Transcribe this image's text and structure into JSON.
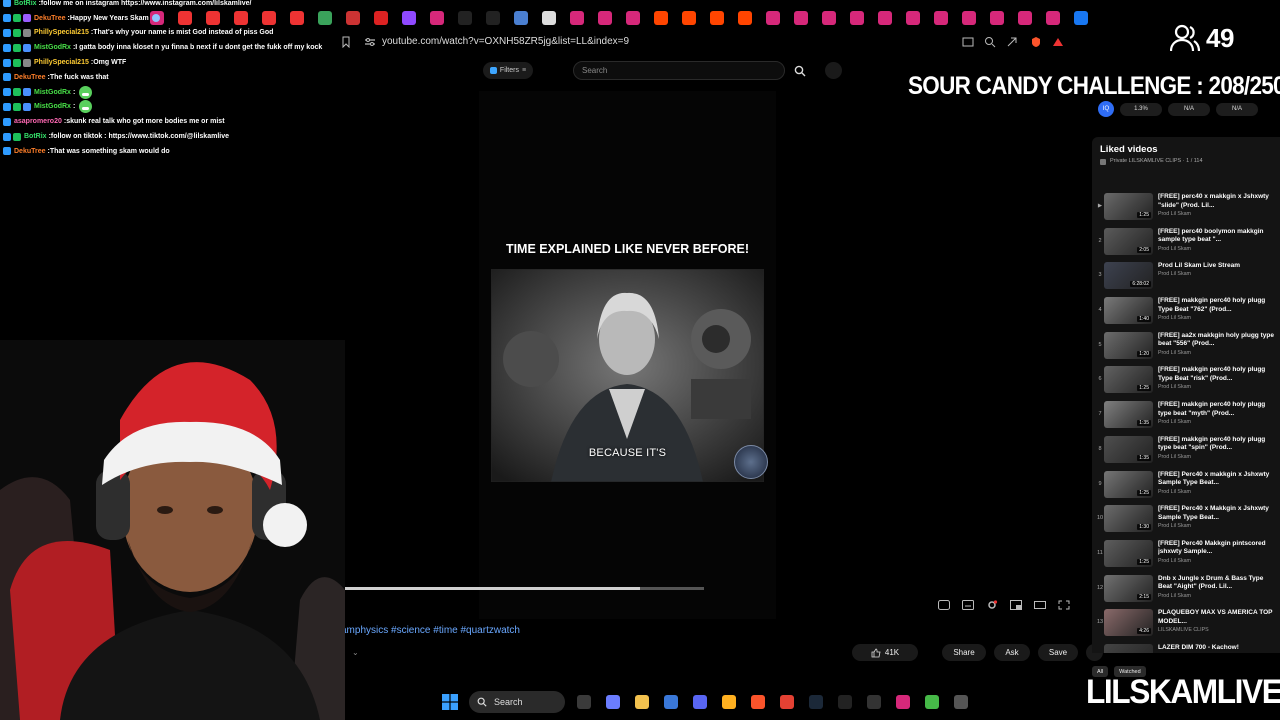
{
  "browser": {
    "tabs": [
      {
        "icon": "instagram-icon",
        "color": "#d6287a"
      },
      {
        "icon": "youtube-icon",
        "color": "#e33"
      },
      {
        "icon": "youtube-icon",
        "color": "#e33"
      },
      {
        "icon": "youtube-icon",
        "color": "#e33"
      },
      {
        "icon": "youtube-icon",
        "color": "#e33"
      },
      {
        "icon": "youtube-icon",
        "color": "#e33"
      },
      {
        "icon": "chrome-web-icon",
        "color": "#3aa35b"
      },
      {
        "icon": "red-app-icon",
        "color": "#c33"
      },
      {
        "icon": "pinterest-icon",
        "color": "#d22"
      },
      {
        "icon": "twitch-icon",
        "color": "#8f49ff"
      },
      {
        "icon": "instagram-icon",
        "color": "#d6287a"
      },
      {
        "icon": "tiktok-icon",
        "color": "#222"
      },
      {
        "icon": "x-icon",
        "color": "#222"
      },
      {
        "icon": "grid-app-icon",
        "color": "#4a7fd1"
      },
      {
        "icon": "google-icon",
        "color": "#ddd"
      },
      {
        "icon": "instagram-icon",
        "color": "#d6287a"
      },
      {
        "icon": "instagram-icon",
        "color": "#d6287a"
      },
      {
        "icon": "instagram-icon",
        "color": "#d6287a"
      },
      {
        "icon": "reddit-icon",
        "color": "#ff4500"
      },
      {
        "icon": "reddit-icon",
        "color": "#ff4500"
      },
      {
        "icon": "reddit-icon",
        "color": "#ff4500"
      },
      {
        "icon": "reddit-icon",
        "color": "#ff4500"
      },
      {
        "icon": "instagram-icon",
        "color": "#d6287a"
      },
      {
        "icon": "instagram-icon",
        "color": "#d6287a"
      },
      {
        "icon": "instagram-icon",
        "color": "#d6287a"
      },
      {
        "icon": "instagram-icon",
        "color": "#d6287a"
      },
      {
        "icon": "instagram-icon",
        "color": "#d6287a"
      },
      {
        "icon": "instagram-icon",
        "color": "#d6287a"
      },
      {
        "icon": "instagram-icon",
        "color": "#d6287a"
      },
      {
        "icon": "instagram-icon",
        "color": "#d6287a"
      },
      {
        "icon": "instagram-icon",
        "color": "#d6287a"
      },
      {
        "icon": "instagram-icon",
        "color": "#d6287a"
      },
      {
        "icon": "instagram-icon",
        "color": "#d6287a"
      },
      {
        "icon": "facebook-icon",
        "color": "#1877f2"
      }
    ],
    "url": "youtube.com/watch?v=OXNH58ZR5jg&list=LL&index=9"
  },
  "youtube": {
    "filters_label": "Filters",
    "search_placeholder": "Search",
    "video_title": "TIME EXPLAINED LIKE NEVER BEFORE!",
    "caption": "BECAUSE IT'S",
    "hashtags": "amphysics #science #time #quartzwatch",
    "likes": "41K",
    "share_label": "Share",
    "ask_label": "Ask",
    "save_label": "Save",
    "progress_fraction": 0.83
  },
  "extension_stats": {
    "logo": "IQ",
    "values": [
      "1.3%",
      "N/A",
      "N/A"
    ]
  },
  "playlist": {
    "title": "Liked videos",
    "subtitle": "Private  LILSKAMLIVE CLIPS  ·  1 / 114",
    "items": [
      {
        "index": "▶",
        "title": "[FREE] perc40 x makkgin x Jshxwty \"slide\" (Prod. Lil...",
        "channel": "Prod Lil Skam",
        "duration": "1:25",
        "thumb": "#6a6a6a"
      },
      {
        "index": "2",
        "title": "[FREE] perc40 boolymon makkgin sample type beat \"...",
        "channel": "Prod Lil Skam",
        "duration": "2:05",
        "thumb": "#5b5b5b"
      },
      {
        "index": "3",
        "title": "Prod Lil Skam Live Stream",
        "channel": "Prod Lil Skam",
        "duration": "6:28:02",
        "thumb": "#3d4250"
      },
      {
        "index": "4",
        "title": "[FREE] makkgin perc40 holy plugg Type Beat \"762\" (Prod...",
        "channel": "Prod Lil Skam",
        "duration": "1:40",
        "thumb": "#7a7a7a"
      },
      {
        "index": "5",
        "title": "[FREE] aa2x makkgin holy plugg type beat \"556\" (Prod...",
        "channel": "Prod Lil Skam",
        "duration": "1:20",
        "thumb": "#6d6d6d"
      },
      {
        "index": "6",
        "title": "[FREE] makkgin perc40 holy plugg Type Beat \"risk\" (Prod...",
        "channel": "Prod Lil Skam",
        "duration": "1:25",
        "thumb": "#626262"
      },
      {
        "index": "7",
        "title": "[FREE] makkgin perc40 holy plugg type beat \"myth\" (Prod...",
        "channel": "Prod Lil Skam",
        "duration": "1:35",
        "thumb": "#808080"
      },
      {
        "index": "8",
        "title": "[FREE] makkgin perc40 holy plugg type beat \"spin\" (Prod...",
        "channel": "Prod Lil Skam",
        "duration": "1:35",
        "thumb": "#4f4f4f"
      },
      {
        "index": "9",
        "title": "[FREE] Perc40 x makkgin x Jshxwty Sample Type Beat...",
        "channel": "Prod Lil Skam",
        "duration": "1:25",
        "thumb": "#767676"
      },
      {
        "index": "10",
        "title": "[FREE] Perc40 x Makkgin x Jshxwty Sample Type Beat...",
        "channel": "Prod Lil Skam",
        "duration": "1:30",
        "thumb": "#6c6c6c"
      },
      {
        "index": "11",
        "title": "[FREE] Perc40 Makkgin pintscored jshxwty Sample...",
        "channel": "Prod Lil Skam",
        "duration": "1:25",
        "thumb": "#5e5e5e"
      },
      {
        "index": "12",
        "title": "Dnb x Jungle x Drum & Bass Type Beat \"Aight\" (Prod. Lil...",
        "channel": "Prod Lil Skam",
        "duration": "2:15",
        "thumb": "#717171"
      },
      {
        "index": "13",
        "title": "PLAQUEBOY MAX VS AMERICA TOP MODEL...",
        "channel": "LILSKAMLIVE CLIPS",
        "duration": "4:26",
        "thumb": "#8a6a6a"
      },
      {
        "index": "",
        "title": "LAZER DIM 700 - Kachow!",
        "channel": "",
        "duration": "",
        "thumb": "#444"
      }
    ],
    "chips": [
      "All",
      "Watched"
    ]
  },
  "chat": [
    {
      "user": "BotRix",
      "user_color": "#35e06a",
      "message": "follow me on instagram https://www.instagram.com/lilskamlive/",
      "badges": [
        "#3aa1ff"
      ]
    },
    {
      "user": "DekuTree",
      "user_color": "#ff7f2a",
      "message": "Happy New Years Skam",
      "badges": [
        "#2e9bff",
        "#1dbf5a",
        "#9a5cff"
      ],
      "emote": "globe"
    },
    {
      "user": "PhillySpecial215",
      "user_color": "#ffcc33",
      "message": "That's why your name is mist God instead of piss God",
      "badges": [
        "#2e9bff",
        "#1dbf5a",
        "#888"
      ]
    },
    {
      "user": "MistGodRx",
      "user_color": "#48e048",
      "message": "I gatta body inna kloset n yu finna b next if u dont get the fukk off my kock",
      "badges": [
        "#2e9bff",
        "#1dbf5a",
        "#4a90ff"
      ]
    },
    {
      "user": "PhillySpecial215",
      "user_color": "#ffcc33",
      "message": "Omg WTF",
      "badges": [
        "#2e9bff",
        "#1dbf5a",
        "#888"
      ]
    },
    {
      "user": "DekuTree",
      "user_color": "#ff7f2a",
      "message": "The fuck was that",
      "badges": [
        "#2e9bff"
      ]
    },
    {
      "user": "MistGodRx",
      "user_color": "#48e048",
      "message": "",
      "badges": [
        "#2e9bff",
        "#1dbf5a",
        "#4a90ff"
      ],
      "emote": "tree"
    },
    {
      "user": "MistGodRx",
      "user_color": "#48e048",
      "message": "",
      "badges": [
        "#2e9bff",
        "#1dbf5a",
        "#4a90ff"
      ],
      "emote": "tree"
    },
    {
      "user": "asapromero20",
      "user_color": "#ff69b4",
      "message": "skunk real talk who got more bodies me or mist",
      "badges": [
        "#2e9bff"
      ]
    },
    {
      "user": "BotRix",
      "user_color": "#35e06a",
      "message": "follow on tiktok : https://www.tiktok.com/@lilskamlive",
      "badges": [
        "#2e9bff",
        "#1dbf5a"
      ]
    },
    {
      "user": "DekuTree",
      "user_color": "#ff7f2a",
      "message": "That was something skam would do",
      "badges": [
        "#2e9bff"
      ]
    }
  ],
  "overlay": {
    "viewer_count": "49",
    "challenge": "SOUR CANDY CHALLENGE : 208/250",
    "brand": "LILSKAMLIVE"
  },
  "taskbar": {
    "search_label": "Search",
    "apps": [
      {
        "icon": "widgets-icon",
        "color": "#3a3a3a"
      },
      {
        "icon": "copilot-icon",
        "color": "#6b7dff"
      },
      {
        "icon": "file-explorer-icon",
        "color": "#f2c14e"
      },
      {
        "icon": "store-icon",
        "color": "#3a78d8"
      },
      {
        "icon": "discord-icon",
        "color": "#5865f2"
      },
      {
        "icon": "kick-app-icon",
        "color": "#ffb020"
      },
      {
        "icon": "brave-icon",
        "color": "#fb542b"
      },
      {
        "icon": "chrome-icon",
        "color": "#e34133"
      },
      {
        "icon": "steam-icon",
        "color": "#1b2838"
      },
      {
        "icon": "obs-icon",
        "color": "#222"
      },
      {
        "icon": "capcut-icon",
        "color": "#333"
      },
      {
        "icon": "instagram-app-icon",
        "color": "#d6287a"
      },
      {
        "icon": "xbox-icon",
        "color": "#46b948"
      },
      {
        "icon": "notepad-icon",
        "color": "#555"
      }
    ]
  }
}
